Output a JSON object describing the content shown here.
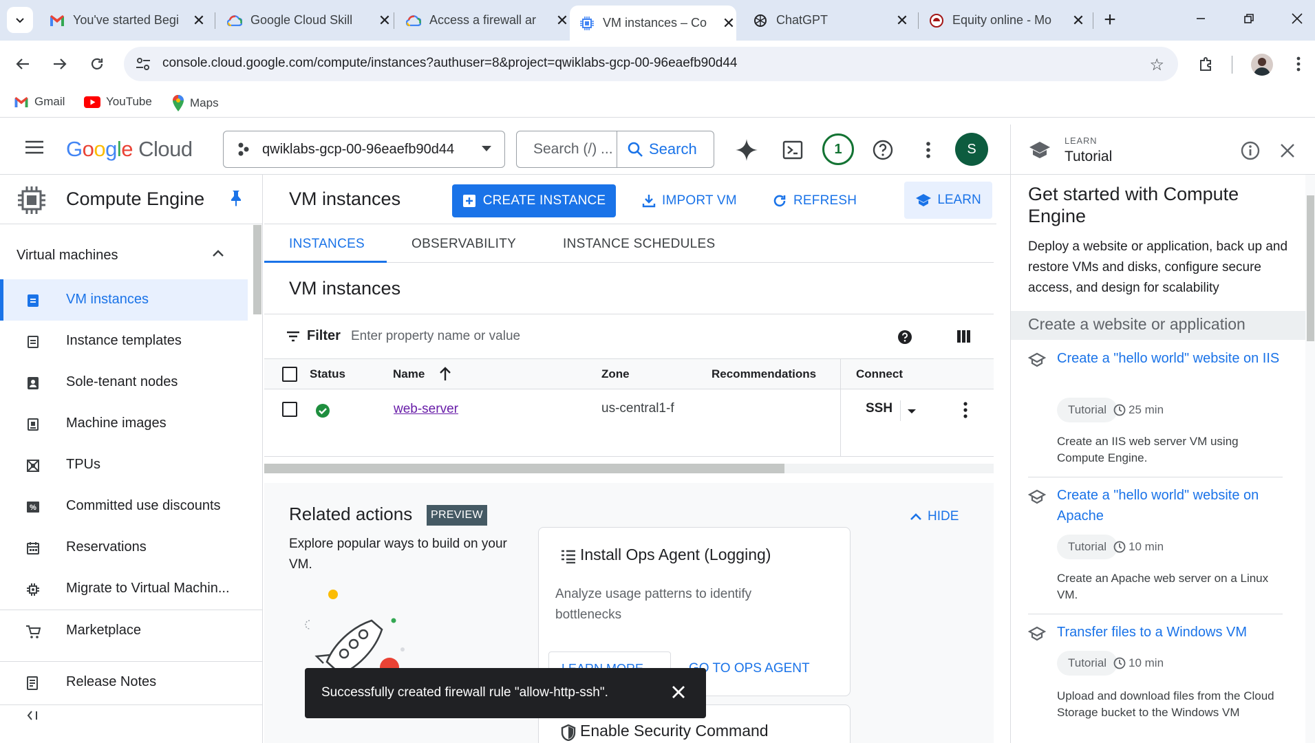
{
  "browser": {
    "tabs": [
      {
        "title": "You've started Begi",
        "icon": "gmail-icon"
      },
      {
        "title": "Google Cloud Skill",
        "icon": "google-cloud-icon"
      },
      {
        "title": "Access a firewall ar",
        "icon": "google-cloud-icon"
      },
      {
        "title": "VM instances – Co",
        "icon": "compute-engine-icon",
        "active": true
      },
      {
        "title": "ChatGPT",
        "icon": "chatgpt-icon"
      },
      {
        "title": "Equity online - Mo",
        "icon": "equity-icon"
      }
    ],
    "url": "console.cloud.google.com/compute/instances?authuser=8&project=qwiklabs-gcp-00-96eaefb90d44",
    "bookmarks": [
      {
        "label": "Gmail",
        "icon": "gmail-icon"
      },
      {
        "label": "YouTube",
        "icon": "youtube-icon"
      },
      {
        "label": "Maps",
        "icon": "maps-icon"
      }
    ]
  },
  "header": {
    "logo_google": "Google",
    "logo_cloud": "Cloud",
    "project": "qwiklabs-gcp-00-96eaefb90d44",
    "search_placeholder": "Search (/) ...",
    "search_button": "Search",
    "notification_count": "1",
    "avatar_letter": "S"
  },
  "sidebar": {
    "title": "Compute Engine",
    "section": "Virtual machines",
    "items": [
      {
        "label": "VM instances",
        "icon": "vm-icon",
        "active": true
      },
      {
        "label": "Instance templates",
        "icon": "template-icon"
      },
      {
        "label": "Sole-tenant nodes",
        "icon": "sole-tenant-icon"
      },
      {
        "label": "Machine images",
        "icon": "machine-image-icon"
      },
      {
        "label": "TPUs",
        "icon": "tpu-icon"
      },
      {
        "label": "Committed use discounts",
        "icon": "discount-icon"
      },
      {
        "label": "Reservations",
        "icon": "calendar-icon"
      },
      {
        "label": "Migrate to Virtual Machin...",
        "icon": "migrate-icon"
      }
    ],
    "marketplace": "Marketplace",
    "release_notes": "Release Notes",
    "collapse": "<|"
  },
  "main": {
    "title": "VM instances",
    "create_button": "CREATE INSTANCE",
    "import_button": "IMPORT VM",
    "refresh_button": "REFRESH",
    "learn_button": "LEARN",
    "tabs": [
      "INSTANCES",
      "OBSERVABILITY",
      "INSTANCE SCHEDULES"
    ],
    "section_title": "VM instances",
    "filter_label": "Filter",
    "filter_placeholder": "Enter property name or value",
    "columns": [
      "Status",
      "Name",
      "Zone",
      "Recommendations",
      "Connect"
    ],
    "rows": [
      {
        "status": "running",
        "name": "web-server",
        "zone": "us-central1-f",
        "recommendations": "",
        "connect": "SSH"
      }
    ]
  },
  "related": {
    "title": "Related actions",
    "badge": "PREVIEW",
    "hide": "HIDE",
    "description": "Explore popular ways to build on your VM.",
    "card1": {
      "title": "Install Ops Agent (Logging)",
      "description": "Analyze usage patterns to identify bottlenecks",
      "learn_more": "LEARN MORE",
      "go": "GO TO OPS AGENT"
    },
    "card2": {
      "title": "Enable Security Command"
    }
  },
  "toast": {
    "message": "Successfully created firewall rule \"allow-http-ssh\"."
  },
  "tutorial": {
    "caption": "LEARN",
    "header_title": "Tutorial",
    "title": "Get started with Compute Engine",
    "description": "Deploy a website or application, back up and restore VMs and disks, configure secure access, and design for scalability",
    "subheading": "Create a website or application",
    "items": [
      {
        "title": "Create a \"hello world\" website on IIS",
        "chip": "Tutorial",
        "duration": "25 min",
        "description": "Create an IIS web server VM using Compute Engine."
      },
      {
        "title": "Create a \"hello world\" website on Apache",
        "chip": "Tutorial",
        "duration": "10 min",
        "description": "Create an Apache web server on a Linux VM."
      },
      {
        "title": "Transfer files to a Windows VM",
        "chip": "Tutorial",
        "duration": "10 min",
        "description": "Upload and download files from the Cloud Storage bucket to the Windows VM"
      }
    ]
  }
}
